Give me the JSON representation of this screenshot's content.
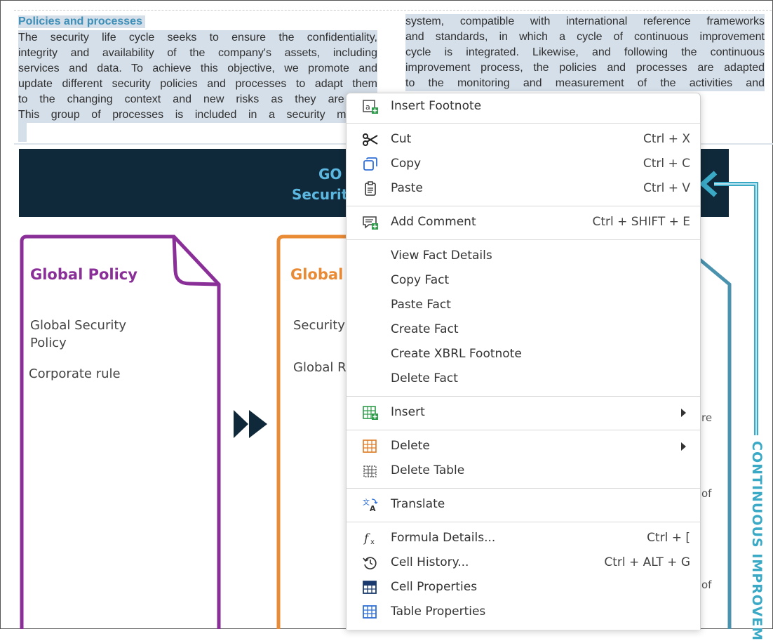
{
  "document": {
    "section_title": "Policies and processes",
    "left_lines": [
      "The security life cycle seeks to ensure the confidentiality,",
      "integrity and availability of the company's assets, including",
      "services and data. To achieve this objective, we promote and",
      "update different security policies and processes to adapt them",
      "to the changing context and new risks as they are iden",
      "This group of processes is included in a security manage"
    ],
    "right_lines": [
      "system, compatible with international reference frameworks",
      "and standards, in which a cycle of continuous improvement",
      "cycle is integrated. Likewise, and following the continuous",
      "improvement process, the policies and processes are adapted",
      "to the monitoring and measurement of the activities and"
    ]
  },
  "infographic": {
    "banner_line1": "GO",
    "banner_line2": "Securit",
    "card1": {
      "title": "Global Policy",
      "item1_line1": "Global Security",
      "item1_line2": "Policy",
      "item2": "Corporate rule",
      "color": "#8a2e98"
    },
    "card2": {
      "title": "Global",
      "item1": "Security",
      "item2": "Global Ri",
      "color": "#e98a35"
    },
    "right_peek": [
      "re",
      "of",
      "of"
    ],
    "vertical_label": "CONTINUOUS IMPROVEM",
    "banner_color": "#10293a",
    "accent_color": "#3aa9c6"
  },
  "context_menu": {
    "items": [
      {
        "label": "Insert Footnote",
        "shortcut": "",
        "icon": "insert-footnote-icon"
      },
      {
        "label": "Cut",
        "shortcut": "Ctrl + X",
        "icon": "scissors-icon"
      },
      {
        "label": "Copy",
        "shortcut": "Ctrl + C",
        "icon": "copy-icon"
      },
      {
        "label": "Paste",
        "shortcut": "Ctrl + V",
        "icon": "clipboard-icon"
      },
      {
        "label": "Add Comment",
        "shortcut": "Ctrl + SHIFT + E",
        "icon": "comment-icon"
      },
      {
        "label": "View Fact Details",
        "shortcut": ""
      },
      {
        "label": "Copy Fact",
        "shortcut": ""
      },
      {
        "label": "Paste Fact",
        "shortcut": ""
      },
      {
        "label": "Create Fact",
        "shortcut": ""
      },
      {
        "label": "Create XBRL Footnote",
        "shortcut": ""
      },
      {
        "label": "Delete Fact",
        "shortcut": ""
      },
      {
        "label": "Insert",
        "shortcut": "",
        "icon": "table-insert-icon",
        "submenu": true
      },
      {
        "label": "Delete",
        "shortcut": "",
        "icon": "table-delete-icon",
        "submenu": true
      },
      {
        "label": "Delete Table",
        "shortcut": "",
        "icon": "delete-table-icon"
      },
      {
        "label": "Translate",
        "shortcut": "",
        "icon": "translate-icon"
      },
      {
        "label": "Formula Details...",
        "shortcut": "Ctrl + [",
        "icon": "formula-icon"
      },
      {
        "label": "Cell History...",
        "shortcut": "Ctrl + ALT + G",
        "icon": "history-icon"
      },
      {
        "label": "Cell Properties",
        "shortcut": "",
        "icon": "cell-properties-icon"
      },
      {
        "label": "Table Properties",
        "shortcut": "",
        "icon": "table-properties-icon"
      }
    ]
  }
}
